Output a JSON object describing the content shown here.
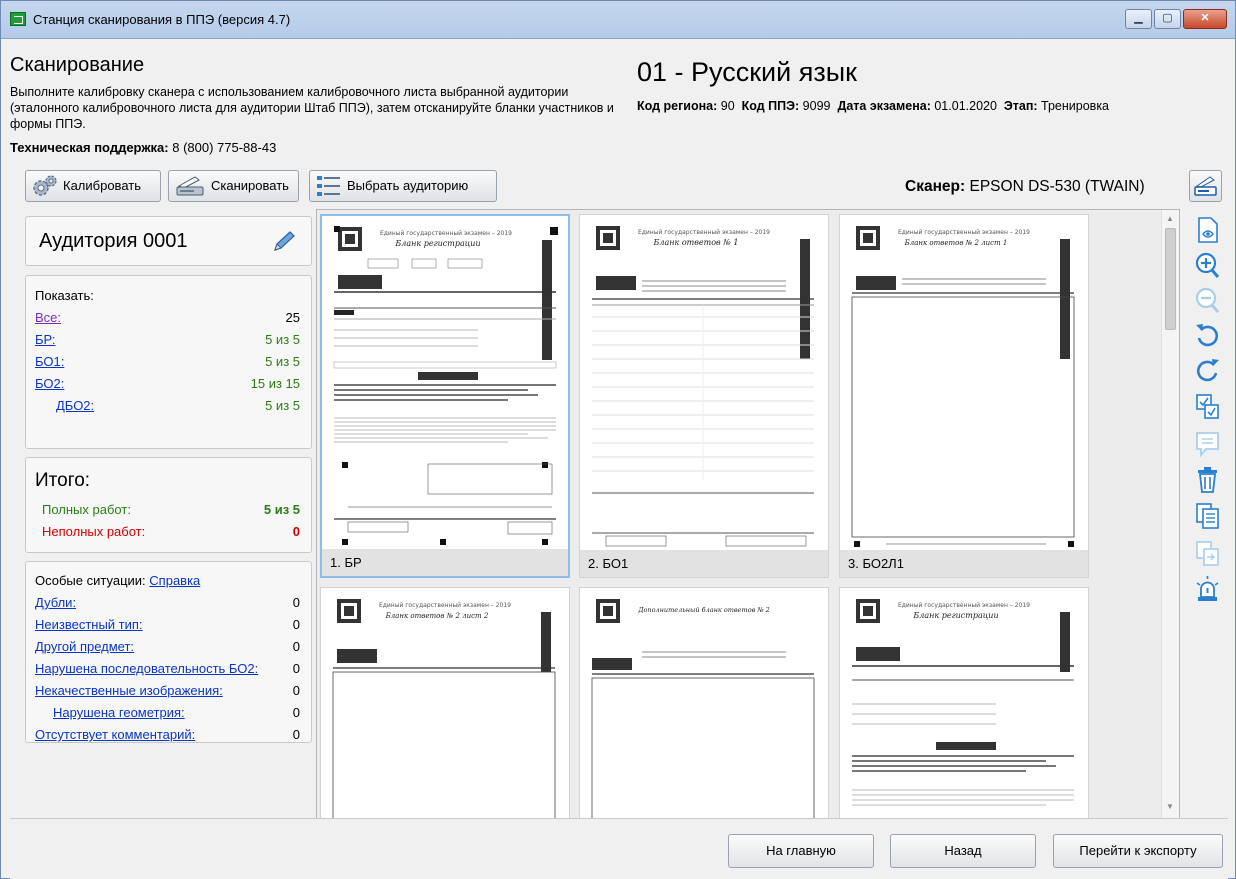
{
  "window": {
    "title": "Станция сканирования в ППЭ (версия 4.7)",
    "min_glyph": "▁",
    "max_glyph": "▢",
    "close_glyph": "✕"
  },
  "header": {
    "title": "Сканирование",
    "description": "Выполните калибровку сканера с использованием калибровочного листа выбранной аудитории (эталонного калибровочного листа для аудитории Штаб ППЭ), затем отсканируйте бланки участников и формы ППЭ.",
    "support_label": "Техническая поддержка:",
    "support_phone": "8 (800) 775-88-43",
    "subject": "01 - Русский язык",
    "region_label": "Код региона:",
    "region_value": "90",
    "ppe_label": "Код ППЭ:",
    "ppe_value": "9099",
    "date_label": "Дата экзамена:",
    "date_value": "01.01.2020",
    "stage_label": "Этап:",
    "stage_value": "Тренировка"
  },
  "toolbar": {
    "calibrate": "Калибровать",
    "scan": "Сканировать",
    "select_room": "Выбрать аудиторию",
    "scanner_label": "Сканер:",
    "scanner_value": "EPSON DS-530 (TWAIN)"
  },
  "room": {
    "title": "Аудитория 0001"
  },
  "show": {
    "label": "Показать:",
    "rows": [
      {
        "key": "Все:",
        "value": "25"
      },
      {
        "key": "БР:",
        "value": "5 из 5"
      },
      {
        "key": "БО1:",
        "value": "5 из 5"
      },
      {
        "key": "БО2:",
        "value": "15 из 15"
      },
      {
        "key": "ДБО2:",
        "value": "5 из 5"
      }
    ]
  },
  "total": {
    "title": "Итого:",
    "full_label": "Полных работ:",
    "full_value": "5 из 5",
    "incomplete_label": "Неполных работ:",
    "incomplete_value": "0"
  },
  "special": {
    "label": "Особые ситуации:",
    "help_link": "Справка",
    "rows": [
      {
        "key": "Дубли:",
        "value": "0"
      },
      {
        "key": "Неизвестный тип:",
        "value": "0"
      },
      {
        "key": "Другой предмет:",
        "value": "0"
      },
      {
        "key": "Нарушена последовательность БО2:",
        "value": "0"
      },
      {
        "key": "Некачественные изображения:",
        "value": "0"
      },
      {
        "key": "Нарушена геометрия:",
        "value": "0"
      },
      {
        "key": "Отсутствует комментарий:",
        "value": "0"
      }
    ]
  },
  "gallery": {
    "items": [
      {
        "caption": "1. БР",
        "sheet_title": "Бланк регистрации"
      },
      {
        "caption": "2. БО1",
        "sheet_title": "Бланк ответов № 1"
      },
      {
        "caption": "3. БО2Л1",
        "sheet_title": "Бланк ответов № 2 лист 1"
      },
      {
        "caption": "",
        "sheet_title": "Бланк ответов № 2 лист 2"
      },
      {
        "caption": "",
        "sheet_title": "Дополнительный бланк ответов № 2"
      },
      {
        "caption": "",
        "sheet_title": "Бланк регистрации"
      }
    ]
  },
  "bottom": {
    "home": "На главную",
    "back": "Назад",
    "export": "Перейти к экспорту"
  },
  "colors": {
    "link": "#0b35c8",
    "visited_link": "#7a2dbd",
    "ok_green": "#2b7d15",
    "error_red": "#d40000",
    "tool_blue": "#2a7fd0",
    "selection": "#8fbde6"
  },
  "icons": {
    "calibrate": "gears-icon",
    "scan": "scanner-icon",
    "select_room": "list-icon",
    "edit": "pencil-icon",
    "scanner_settings": "scanner-settings-icon",
    "right_tools": [
      "view-page-icon",
      "zoom-in-icon",
      "zoom-out-icon",
      "rotate-left-icon",
      "rotate-right-icon",
      "mark-icon",
      "comment-icon",
      "delete-icon",
      "copy-icon",
      "replace-icon",
      "alert-icon"
    ]
  }
}
